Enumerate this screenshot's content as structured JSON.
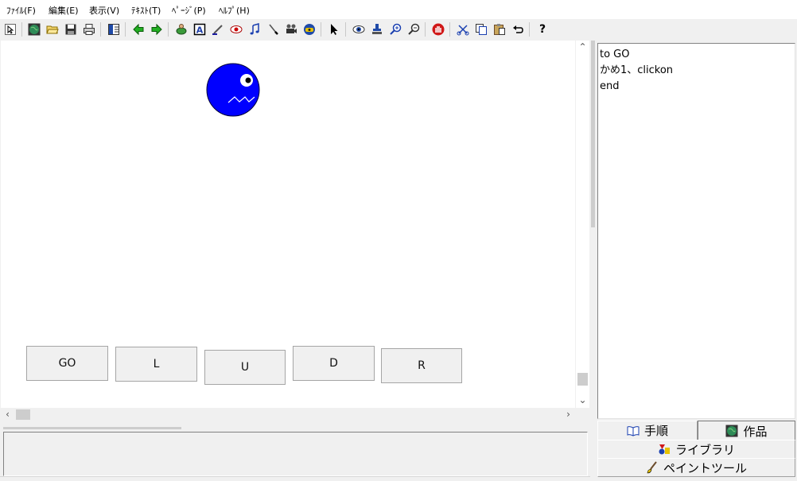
{
  "menubar": {
    "items": [
      "ﾌｧｲﾙ(F)",
      "編集(E)",
      "表示(V)",
      "ﾃｷｽﾄ(T)",
      "ﾍﾟｰｼﾞ(P)",
      "ﾍﾙﾌﾟ(H)"
    ]
  },
  "toolbar": {
    "icons": [
      "select-arrow",
      "globe",
      "open-folder",
      "save",
      "print",
      "layout",
      "back-arrow",
      "forward-arrow",
      "turtle",
      "text-box",
      "pen-tool",
      "eye-red",
      "music-note",
      "brush",
      "film-projector",
      "web-cam",
      "pointer",
      "eye",
      "stamp",
      "zoom-in",
      "zoom-out",
      "stop-hand",
      "scissors",
      "copy",
      "paste",
      "undo",
      "help"
    ],
    "help_label": "?"
  },
  "canvas": {
    "background": "#ffffff",
    "turtle_color": "#0000ff",
    "buttons": [
      "GO",
      "L",
      "U",
      "D",
      "R"
    ]
  },
  "procedure": {
    "lines": [
      "to GO",
      "かめ1、clickon",
      "end"
    ]
  },
  "tabs": {
    "procedures": "手順",
    "works": "作品",
    "library": "ライブラリ",
    "paint": "ペイントツール"
  }
}
